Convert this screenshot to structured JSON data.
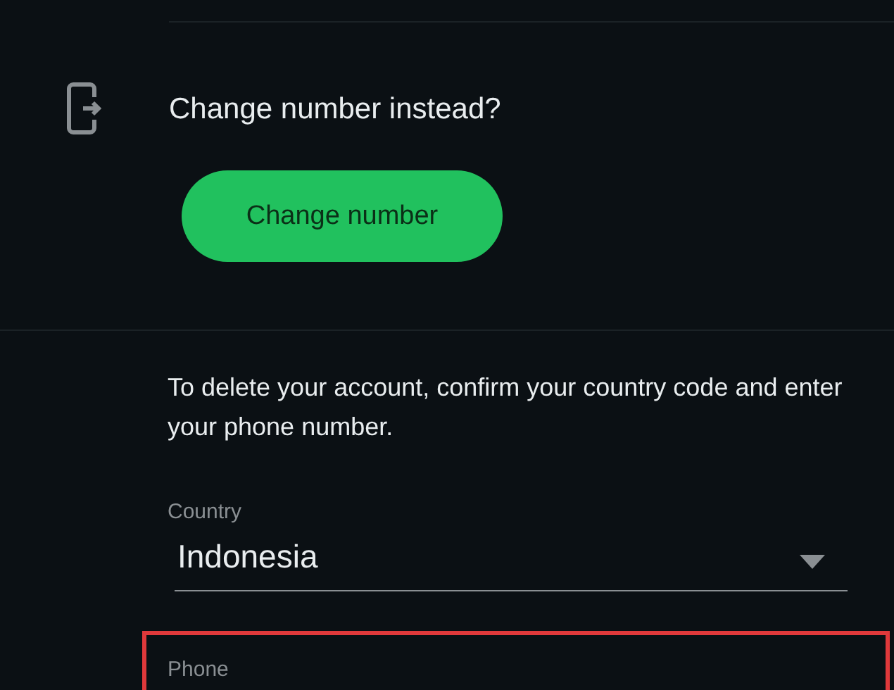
{
  "change_number": {
    "heading": "Change number instead?",
    "button": "Change number"
  },
  "delete_account": {
    "instructions": "To delete your account, confirm your country code and enter your phone number.",
    "country": {
      "label": "Country",
      "value": "Indonesia"
    },
    "phone": {
      "label": "Phone",
      "highlighted": true
    }
  }
}
